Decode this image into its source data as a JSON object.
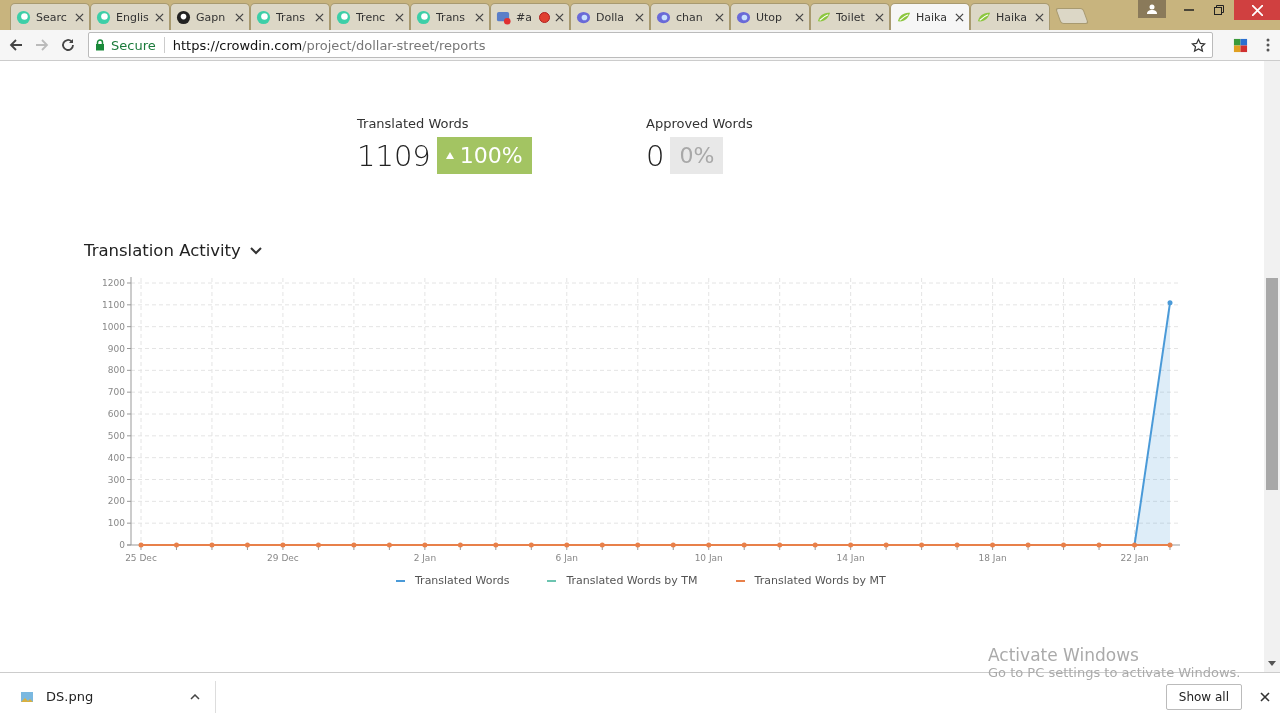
{
  "tabs": [
    {
      "title": "Searc",
      "kind": "swirl",
      "selected": false
    },
    {
      "title": "Englis",
      "kind": "swirl",
      "selected": false
    },
    {
      "title": "Gapn",
      "kind": "octocat",
      "selected": false
    },
    {
      "title": "Trans",
      "kind": "swirl",
      "selected": false
    },
    {
      "title": "Trenc",
      "kind": "swirl",
      "selected": false
    },
    {
      "title": "Trans",
      "kind": "swirl",
      "selected": false
    },
    {
      "title": "#a",
      "kind": "chat",
      "recording": true,
      "selected": false
    },
    {
      "title": "Dolla",
      "kind": "eye",
      "selected": false
    },
    {
      "title": "chan",
      "kind": "eye",
      "selected": false
    },
    {
      "title": "Utop",
      "kind": "eye",
      "selected": false
    },
    {
      "title": "Toilet",
      "kind": "leaf",
      "selected": false
    },
    {
      "title": "Haika",
      "kind": "leaf",
      "selected": true
    },
    {
      "title": "Haika",
      "kind": "leaf",
      "selected": false
    }
  ],
  "address_bar": {
    "security": "Secure",
    "url_host": "https://crowdin.com",
    "url_path": "/project/dollar-street/reports"
  },
  "stats": [
    {
      "label": "Translated Words",
      "value": "1109",
      "change": "100%",
      "kind": "up"
    },
    {
      "label": "Approved Words",
      "value": "0",
      "change": "0%",
      "kind": "flat"
    }
  ],
  "activity": {
    "title": "Translation Activity",
    "chart_data": {
      "type": "line",
      "categories": [
        "25 Dec",
        null,
        null,
        null,
        "29 Dec",
        null,
        null,
        null,
        "2 Jan",
        null,
        null,
        null,
        "6 Jan",
        null,
        null,
        null,
        "10 Jan",
        null,
        null,
        null,
        "14 Jan",
        null,
        null,
        null,
        "18 Jan",
        null,
        null,
        null,
        "22 Jan",
        null
      ],
      "grid": true,
      "ylim": [
        0,
        1200
      ],
      "yticks": [
        0,
        100,
        200,
        300,
        400,
        500,
        600,
        700,
        800,
        900,
        1000,
        1100,
        1200
      ],
      "series": [
        {
          "name": "Translated Words",
          "color": "#4a9ad8",
          "values": [
            null,
            null,
            null,
            null,
            null,
            null,
            null,
            null,
            null,
            null,
            null,
            null,
            null,
            null,
            null,
            null,
            null,
            null,
            null,
            null,
            null,
            null,
            null,
            null,
            null,
            null,
            null,
            null,
            0,
            1109
          ]
        },
        {
          "name": "Translated Words by TM",
          "color": "#6cc4b0",
          "values": [
            null,
            null,
            null,
            null,
            null,
            null,
            null,
            null,
            null,
            null,
            null,
            null,
            null,
            null,
            null,
            null,
            null,
            null,
            null,
            null,
            null,
            null,
            null,
            null,
            null,
            null,
            null,
            null,
            null,
            null
          ]
        },
        {
          "name": "Translated Words by MT",
          "color": "#e8804a",
          "values": [
            0,
            0,
            0,
            0,
            0,
            0,
            0,
            0,
            0,
            0,
            0,
            0,
            0,
            0,
            0,
            0,
            0,
            0,
            0,
            0,
            0,
            0,
            0,
            0,
            0,
            0,
            0,
            0,
            0,
            0
          ]
        }
      ]
    }
  },
  "os_notice": {
    "title": "Activate Windows",
    "text": "Go to PC settings to activate Windows."
  },
  "download_bar": {
    "file": "DS.png",
    "show_all": "Show all"
  }
}
